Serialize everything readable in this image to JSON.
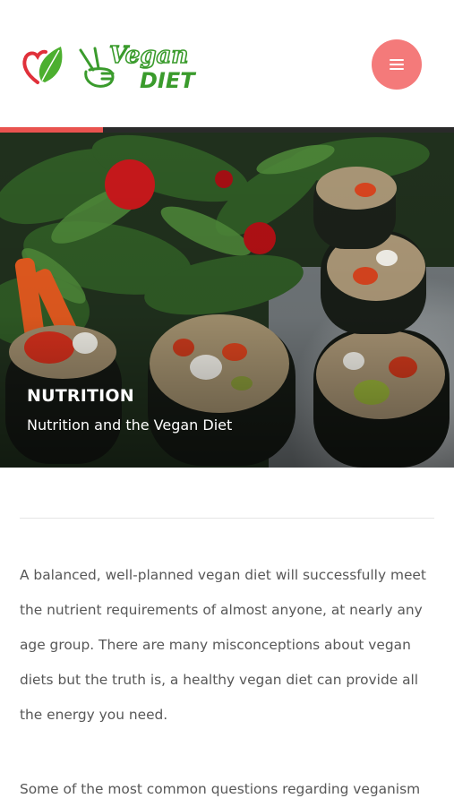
{
  "header": {
    "logo": {
      "word_top": "Vegan",
      "word_bottom": "DIET"
    },
    "menu_icon": "hamburger-icon"
  },
  "hero": {
    "title": "NUTRITION",
    "subtitle": "Nutrition and the Vegan Diet"
  },
  "content": {
    "paragraphs": [
      "A balanced, well-planned vegan diet will successfully meet the nutrient requirements of almost anyone, at nearly any age group. There are many misconceptions about vegan diets but the truth is, a healthy vegan diet can provide all the energy you need.",
      "Some of the most common questions regarding veganism"
    ]
  },
  "colors": {
    "accent": "#f47a7a",
    "accent_bar": "#e9534f",
    "logo_green": "#3a9b2c",
    "logo_red": "#e0303a"
  }
}
